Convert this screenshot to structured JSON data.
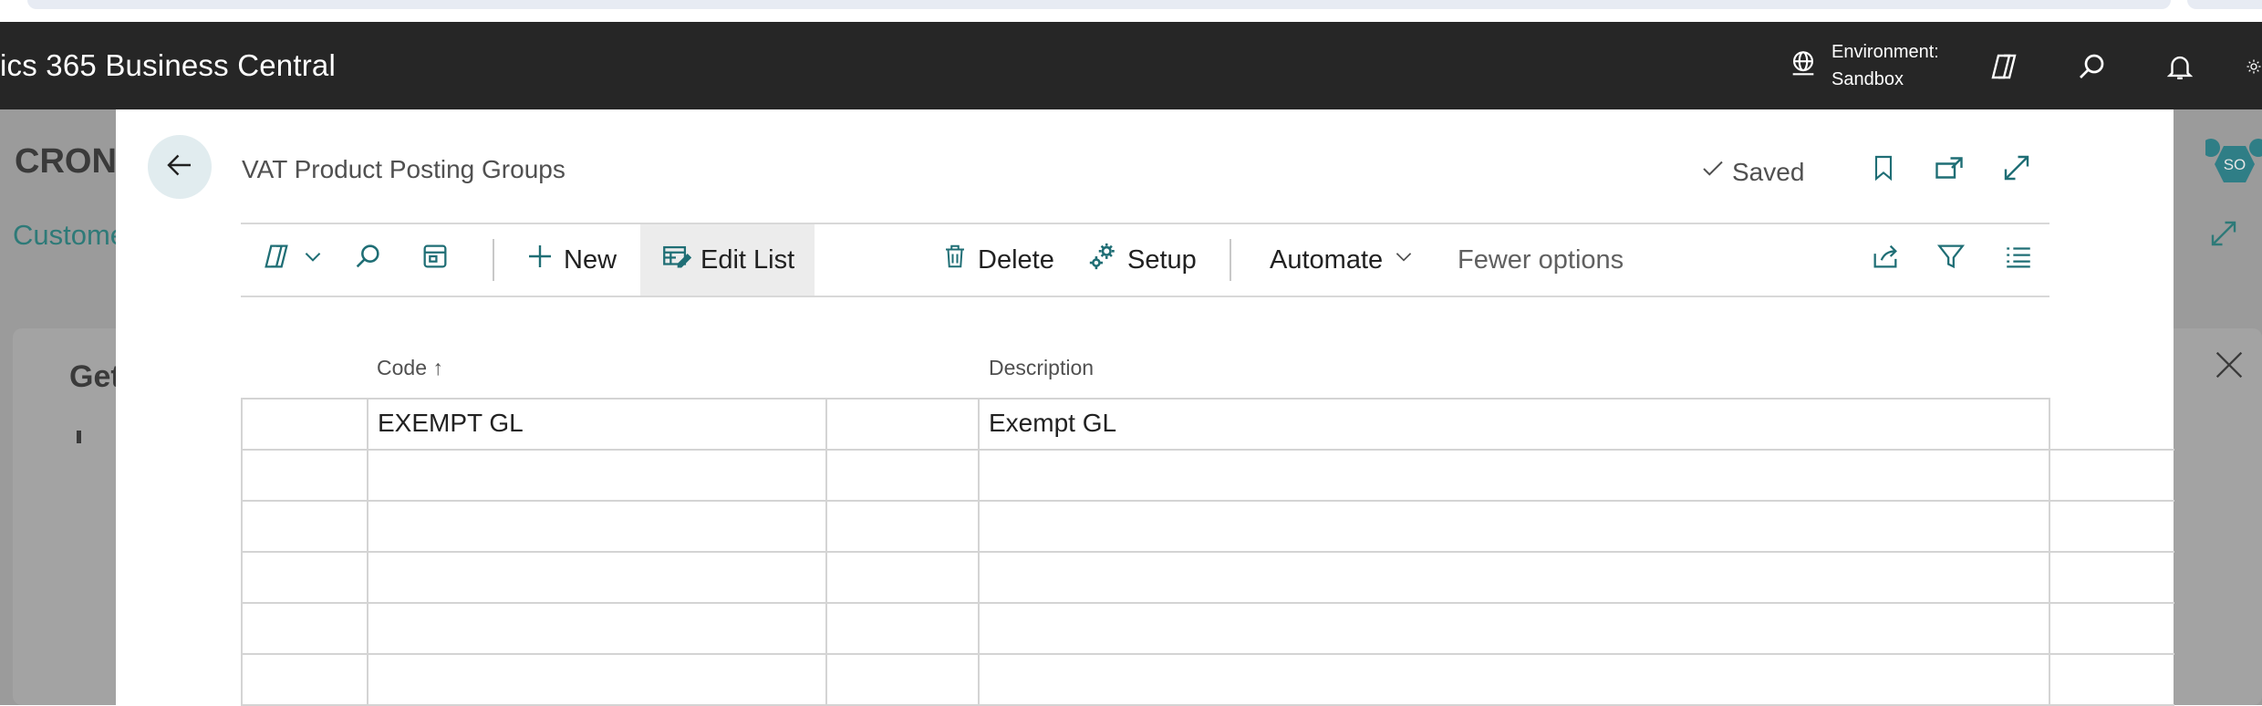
{
  "app": {
    "title": "ics 365 Business Central",
    "environment_label": "Environment:",
    "environment_value": "Sandbox"
  },
  "background": {
    "page_title": "CRON",
    "customer_link": "Custome",
    "card_title": "Get",
    "avatar_initials": "SO"
  },
  "panel": {
    "title": "VAT Product Posting Groups",
    "saved_label": "Saved"
  },
  "toolbar": {
    "new_label": "New",
    "edit_list_label": "Edit List",
    "delete_label": "Delete",
    "setup_label": "Setup",
    "automate_label": "Automate",
    "fewer_options_label": "Fewer options"
  },
  "table": {
    "columns": [
      "Code",
      "Description"
    ],
    "sort_indicator": "↑",
    "rows": [
      {
        "code": "EXEMPT GL",
        "description": "Exempt GL"
      },
      {
        "code": "",
        "description": ""
      },
      {
        "code": "",
        "description": ""
      },
      {
        "code": "",
        "description": ""
      },
      {
        "code": "",
        "description": ""
      },
      {
        "code": "",
        "description": ""
      }
    ]
  },
  "icons": {
    "back": "arrow-left-icon",
    "globe": "globe-icon",
    "copilot": "copilot-icon",
    "search": "search-icon",
    "bell": "bell-icon",
    "settings": "gear-icon",
    "bookmark": "bookmark-icon",
    "open_new": "open-in-new-window-icon",
    "expand": "expand-icon",
    "share": "share-icon",
    "filter": "filter-icon",
    "list": "list-icon"
  },
  "colors": {
    "accent": "#1f6e75",
    "appbar": "#262626"
  }
}
